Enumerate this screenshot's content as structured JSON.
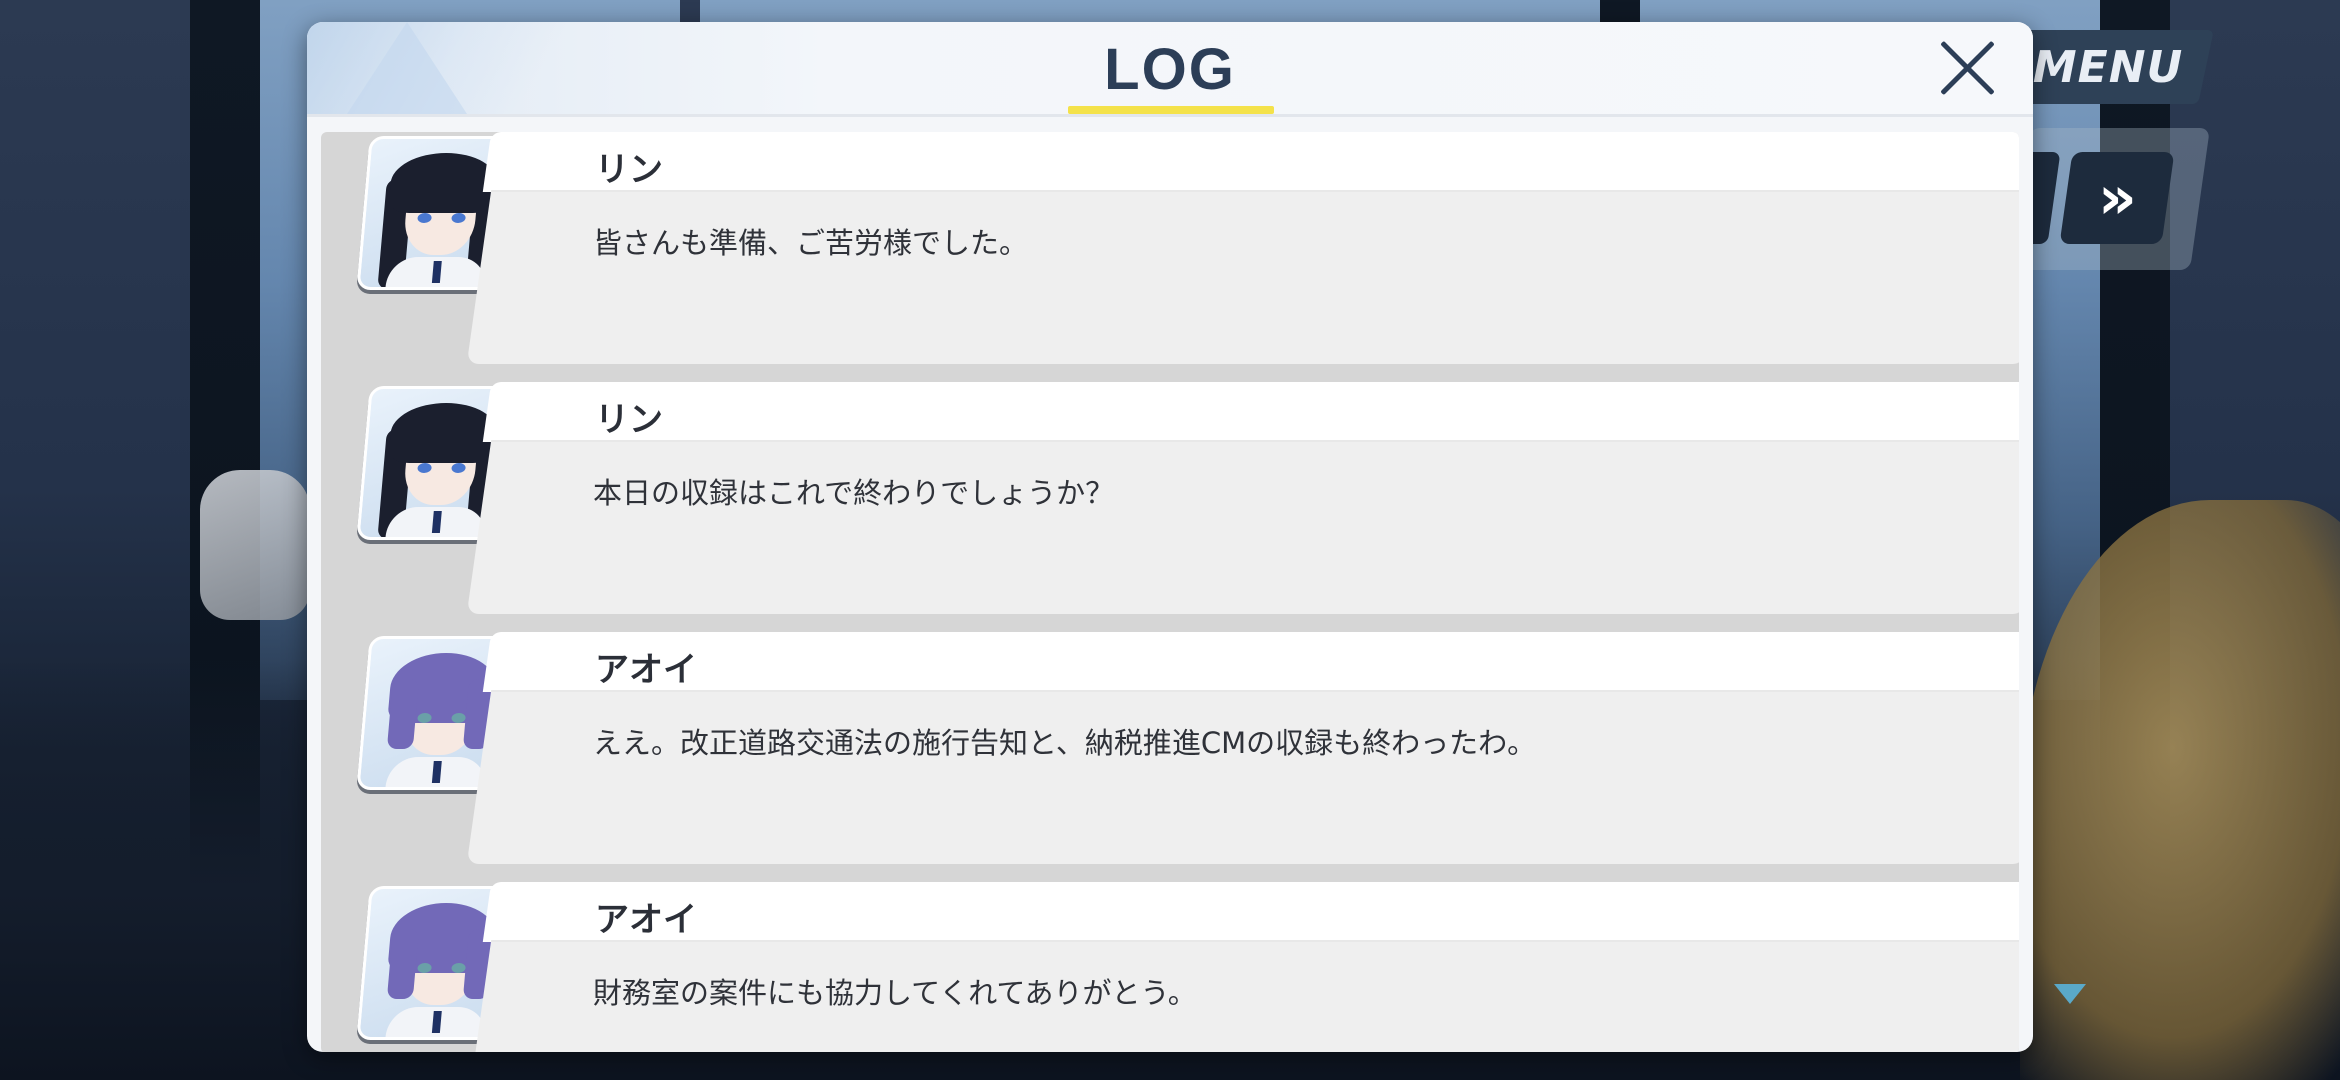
{
  "window": {
    "title": "LOG",
    "close_icon": "close-icon"
  },
  "controls": {
    "menu_label": "MENU",
    "fast_forward_icon": "fast-forward-icon",
    "fast_forward_glyph": "»",
    "scroll_indicator_icon": "chevron-down-icon"
  },
  "colors": {
    "title_underline": "#f4e24a",
    "title_text": "#2c3e57",
    "panel_bg": "#f4f6f9",
    "list_bg": "#d6d6d6",
    "bubble_bg": "#efefef"
  },
  "log": {
    "entries": [
      {
        "speaker": "リン",
        "message": "皆さんも準備、ご苦労様でした。",
        "portrait": "rin-portrait"
      },
      {
        "speaker": "リン",
        "message": "本日の収録はこれで終わりでしょうか？",
        "portrait": "rin-portrait"
      },
      {
        "speaker": "アオイ",
        "message": "ええ。改正道路交通法の施行告知と、納税推進CMの収録も終わったわ。",
        "portrait": "aoi-portrait"
      },
      {
        "speaker": "アオイ",
        "message": "財務室の案件にも協力してくれてありがとう。",
        "portrait": "aoi-portrait"
      }
    ]
  }
}
